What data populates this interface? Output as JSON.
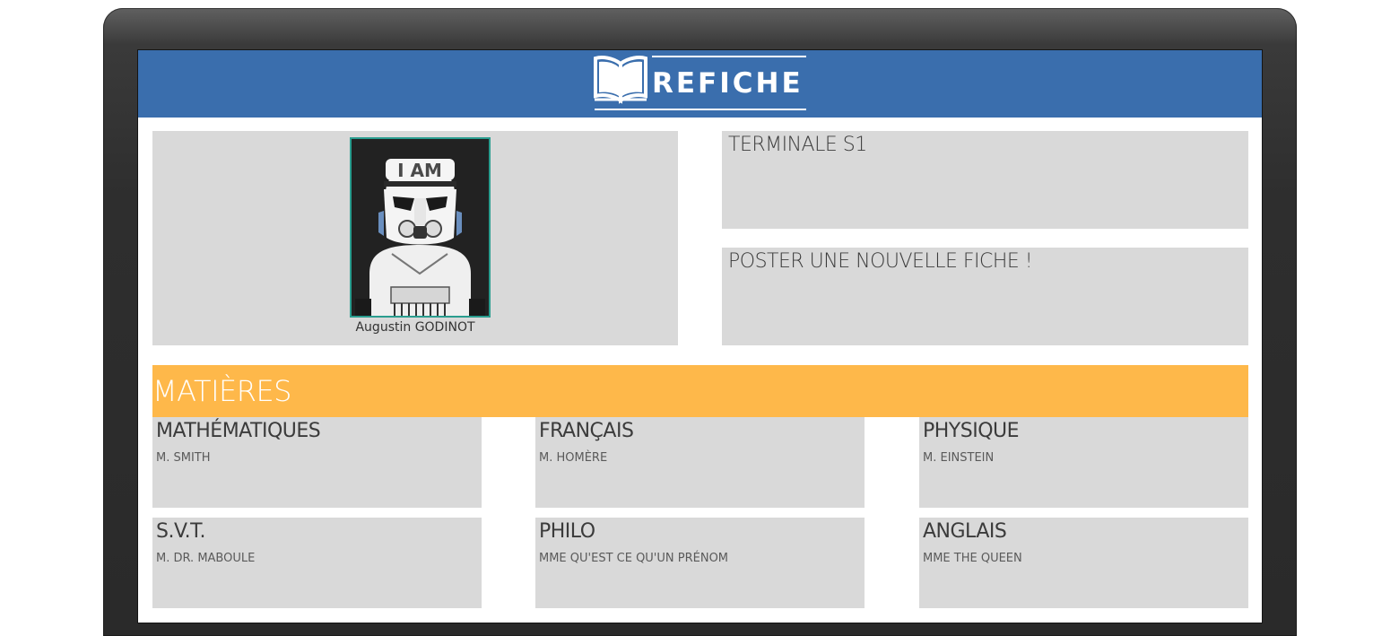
{
  "app": {
    "logo_text": "REFICHE"
  },
  "profile": {
    "name": "Augustin GODINOT",
    "avatar_label": "I AM"
  },
  "class_card": {
    "title": "TERMINALE S1"
  },
  "post_card": {
    "title": "POSTER UNE NOUVELLE FICHE !"
  },
  "subjects_section": {
    "title": "MATIÈRES"
  },
  "subjects": [
    {
      "name": "MATHÉMATIQUES",
      "teacher": "M. SMITH"
    },
    {
      "name": "FRANÇAIS",
      "teacher": "M. HOMÈRE"
    },
    {
      "name": "PHYSIQUE",
      "teacher": "M. EINSTEIN"
    },
    {
      "name": "S.V.T.",
      "teacher": "M. DR. MABOULE"
    },
    {
      "name": "PHILO",
      "teacher": "MME QU'EST CE QU'UN PRÉNOM"
    },
    {
      "name": "ANGLAIS",
      "teacher": "MME THE QUEEN"
    }
  ],
  "colors": {
    "header": "#3a6ead",
    "section_bar": "#feb84a",
    "card": "#d9d9d9",
    "avatar_border": "#2a9d8f"
  },
  "icons": {
    "logo": "open-book-icon",
    "avatar": "stormtrooper-avatar"
  }
}
